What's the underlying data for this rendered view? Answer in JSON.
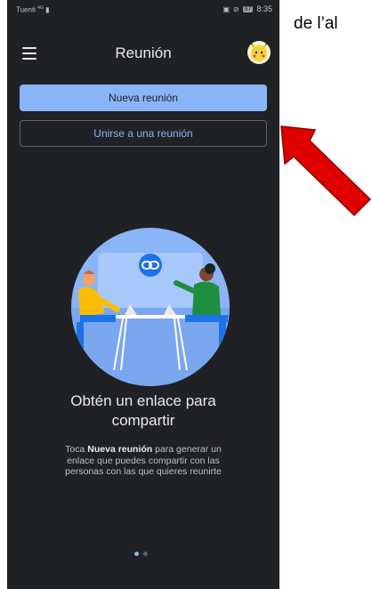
{
  "annotation": {
    "caption": "de l’al"
  },
  "status_bar": {
    "carrier": "Tuenti",
    "signal_tag": "4G",
    "battery": "97",
    "time": "8:35"
  },
  "app_bar": {
    "title": "Reunión",
    "menu_icon": "hamburger-menu-icon",
    "avatar_icon": "pikachu-avatar-icon"
  },
  "buttons": {
    "new_meeting": "Nueva reunión",
    "join_meeting": "Unirse a una reunión"
  },
  "empty_state": {
    "headline": "Obtén un enlace para compartir",
    "body_prefix": "Toca ",
    "body_bold": "Nueva reunión",
    "body_suffix": " para generar un enlace que puedes compartir con las personas con las que quieres reunirte"
  },
  "pager": {
    "pages": 2,
    "active_index": 0
  },
  "colors": {
    "background": "#202124",
    "accent": "#8ab4f8",
    "arrow": "#e00000"
  }
}
